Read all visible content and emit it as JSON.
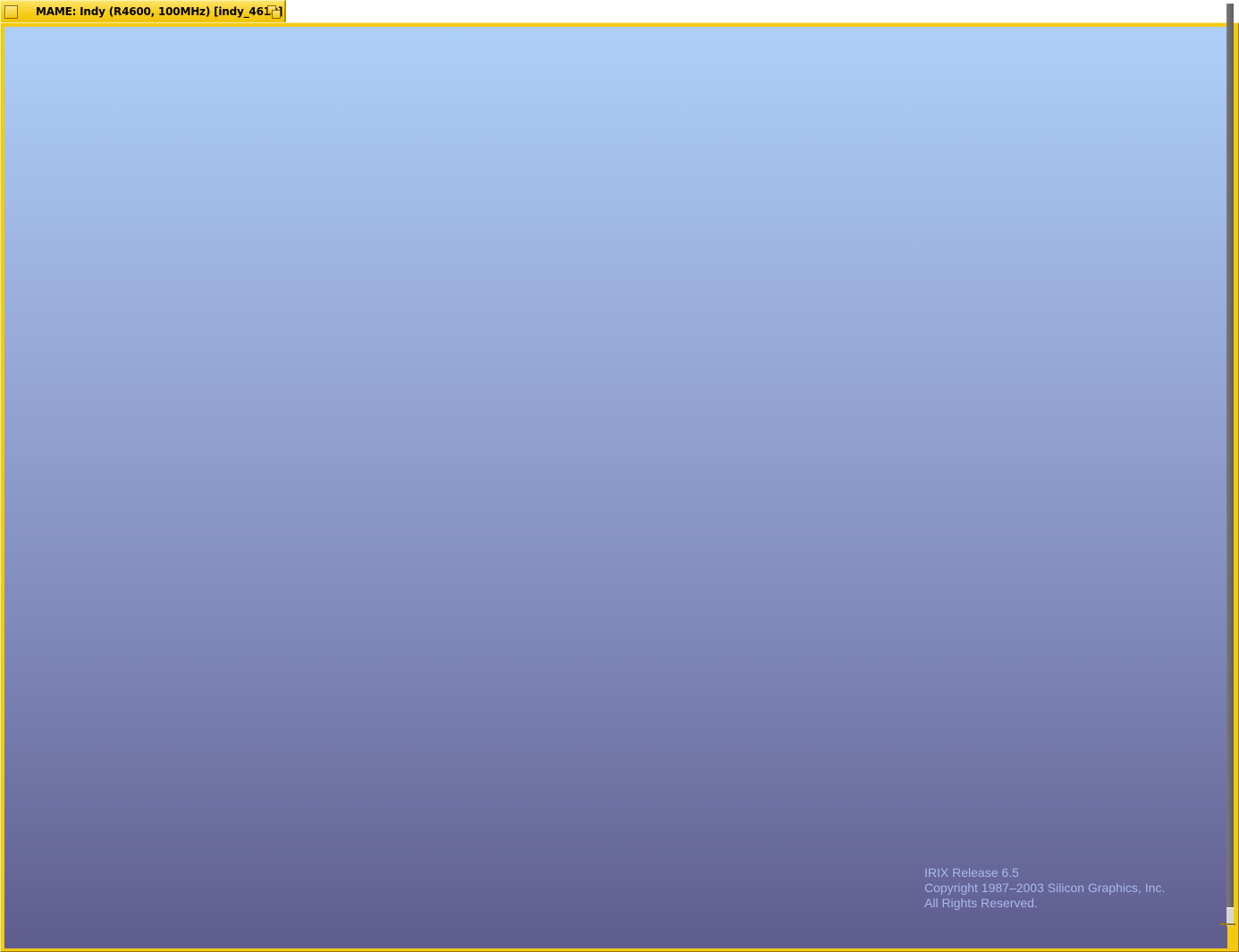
{
  "window": {
    "title": "MAME: Indy (R4600, 100MHz) [indy_4610]",
    "menu_button_icon": "window-menu-icon",
    "iconify_button_icon": "iconify-icon",
    "frame_color": "#f3c914"
  },
  "screen": {
    "background_top": "#aecffa",
    "background_bottom": "#5f5c8e",
    "copyright": {
      "line1": "IRIX Release 6.5",
      "line2": "Copyright 1987–2003 Silicon Graphics, Inc.",
      "line3": "All Rights Reserved."
    }
  }
}
